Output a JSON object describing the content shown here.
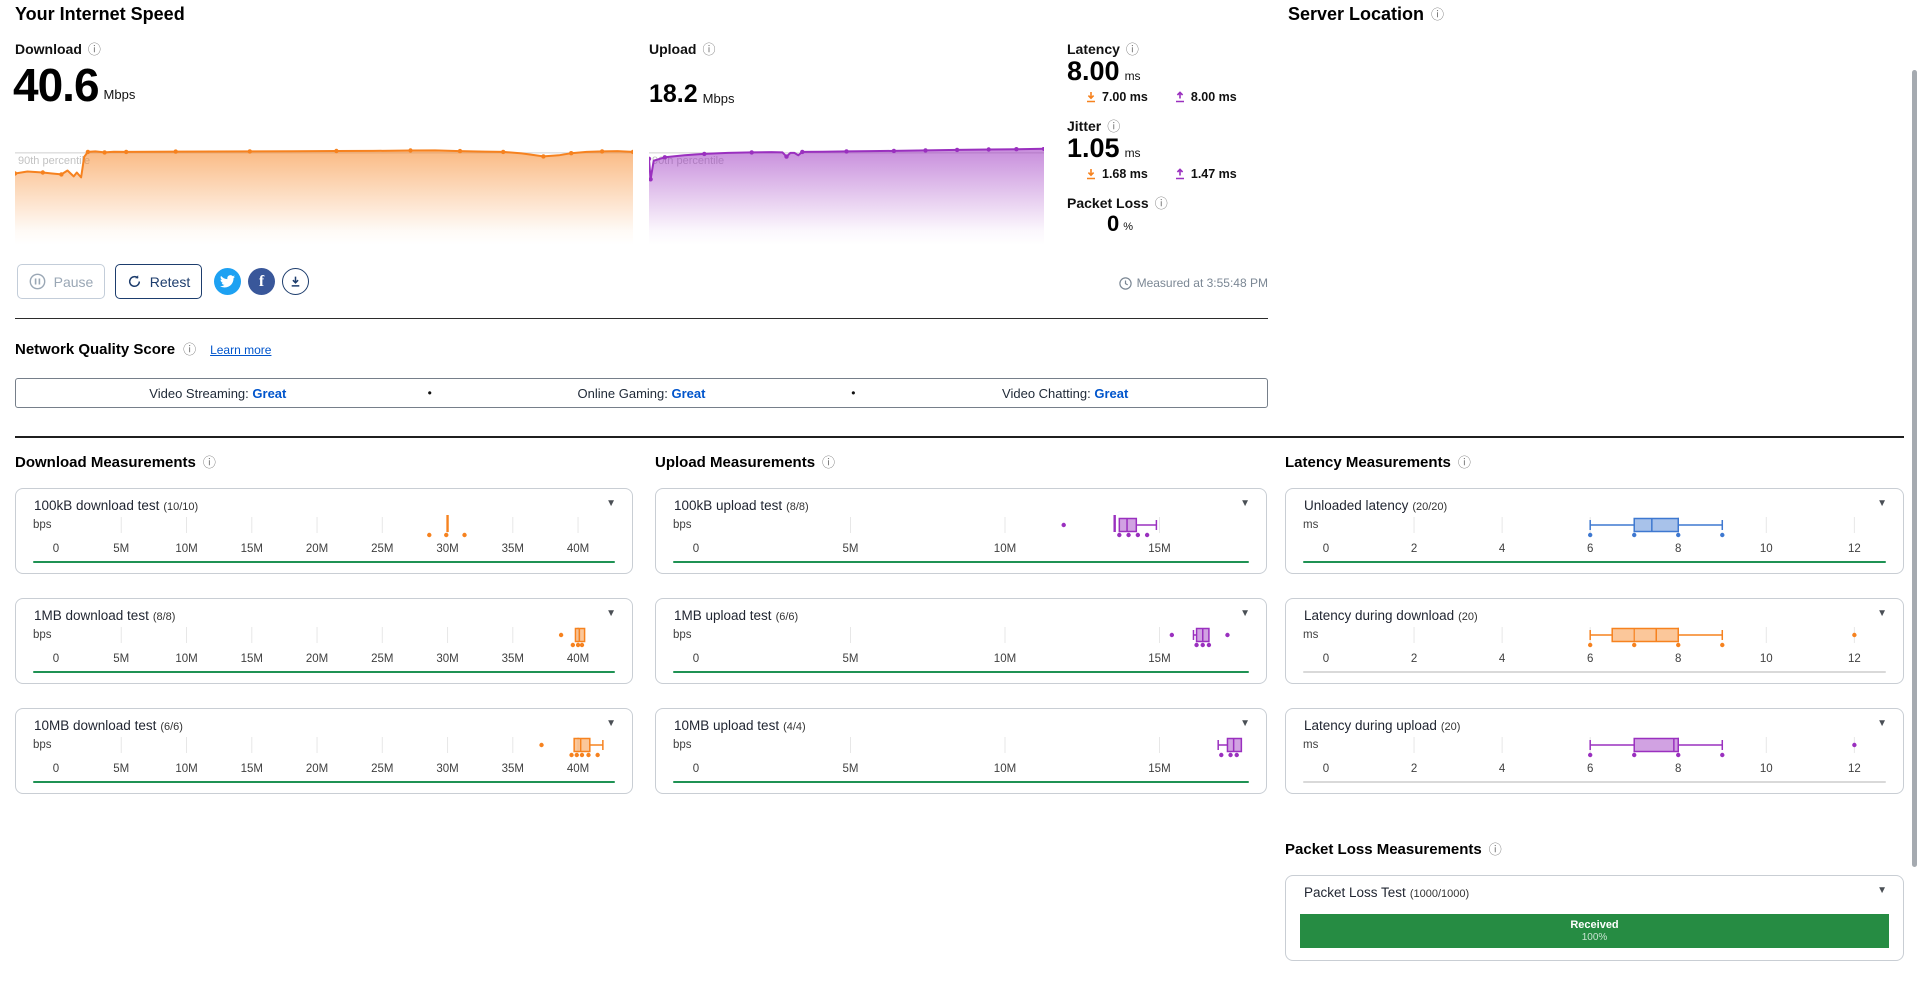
{
  "icons": {
    "info": "ⓘ",
    "caret": "▼",
    "bullet": "•",
    "facebook": "f"
  },
  "colors": {
    "orange": "#f6821f",
    "purple": "#9a30bf",
    "blue_box": "#3e78d0",
    "green_progress": "#1f9254",
    "gray_progress": "#d9d9d9",
    "packet_green": "#268c43",
    "navy": "#1d3d6d",
    "link_blue": "#0055cc",
    "twitter_blue": "#1da1f2",
    "facebook_blue": "#39579a"
  },
  "header": {
    "title": "Your Internet Speed",
    "server_location_title": "Server Location"
  },
  "speed": {
    "download": {
      "label": "Download",
      "value": "40.6",
      "unit": "Mbps"
    },
    "upload": {
      "label": "Upload",
      "value": "18.2",
      "unit": "Mbps"
    },
    "latency": {
      "label": "Latency",
      "value": "8.00",
      "unit": "ms",
      "download_sub": "7.00 ms",
      "upload_sub": "8.00 ms"
    },
    "jitter": {
      "label": "Jitter",
      "value": "1.05",
      "unit": "ms",
      "download_sub": "1.68 ms",
      "upload_sub": "1.47 ms"
    },
    "packet_loss": {
      "label": "Packet Loss",
      "value": "0",
      "unit": "%"
    }
  },
  "toolbar": {
    "pause": "Pause",
    "retest": "Retest",
    "measured_at": "Measured at 3:55:48 PM"
  },
  "quality": {
    "title": "Network Quality Score",
    "learn_more": "Learn more",
    "items": [
      {
        "label": "Video Streaming:",
        "value": "Great"
      },
      {
        "label": "Online Gaming:",
        "value": "Great"
      },
      {
        "label": "Video Chatting:",
        "value": "Great"
      }
    ]
  },
  "chart_data": [
    {
      "type": "area",
      "name": "download-speed",
      "color": "#f6821f",
      "percentile_label": "90th percentile",
      "percentile_y": 0.06,
      "points": [
        [
          0,
          0.27,
          1
        ],
        [
          0.02,
          0.25
        ],
        [
          0.045,
          0.26,
          1
        ],
        [
          0.06,
          0.27
        ],
        [
          0.075,
          0.28,
          1
        ],
        [
          0.085,
          0.24
        ],
        [
          0.095,
          0.3
        ],
        [
          0.1,
          0.26
        ],
        [
          0.107,
          0.31
        ],
        [
          0.112,
          0.1
        ],
        [
          0.118,
          0.05,
          1
        ],
        [
          0.13,
          0.045
        ],
        [
          0.145,
          0.055,
          1
        ],
        [
          0.16,
          0.048
        ],
        [
          0.18,
          0.05,
          1
        ],
        [
          0.22,
          0.048
        ],
        [
          0.26,
          0.047,
          1
        ],
        [
          0.32,
          0.046
        ],
        [
          0.38,
          0.045,
          1
        ],
        [
          0.45,
          0.043
        ],
        [
          0.52,
          0.041,
          1
        ],
        [
          0.58,
          0.04
        ],
        [
          0.64,
          0.036,
          1
        ],
        [
          0.68,
          0.035
        ],
        [
          0.72,
          0.042,
          1
        ],
        [
          0.76,
          0.047
        ],
        [
          0.79,
          0.05,
          1
        ],
        [
          0.82,
          0.065
        ],
        [
          0.855,
          0.096,
          1
        ],
        [
          0.88,
          0.085
        ],
        [
          0.9,
          0.063,
          1
        ],
        [
          0.925,
          0.05
        ],
        [
          0.95,
          0.045,
          1
        ],
        [
          0.975,
          0.042
        ],
        [
          1,
          0.05,
          1
        ]
      ]
    },
    {
      "type": "area",
      "name": "upload-speed",
      "color": "#9a30bf",
      "percentile_label": "90th percentile",
      "percentile_y": 0.06,
      "points": [
        [
          0,
          0.12,
          1
        ],
        [
          0.004,
          0.33,
          1
        ],
        [
          0.012,
          0.14
        ],
        [
          0.04,
          0.105,
          1
        ],
        [
          0.09,
          0.085
        ],
        [
          0.14,
          0.07,
          1
        ],
        [
          0.2,
          0.06
        ],
        [
          0.26,
          0.055,
          1
        ],
        [
          0.31,
          0.052
        ],
        [
          0.338,
          0.055
        ],
        [
          0.348,
          0.098,
          1
        ],
        [
          0.358,
          0.06
        ],
        [
          0.368,
          0.06
        ],
        [
          0.378,
          0.085
        ],
        [
          0.388,
          0.05,
          1
        ],
        [
          0.44,
          0.048
        ],
        [
          0.5,
          0.045,
          1
        ],
        [
          0.56,
          0.042
        ],
        [
          0.62,
          0.04,
          1
        ],
        [
          0.7,
          0.035,
          1
        ],
        [
          0.78,
          0.03,
          1
        ],
        [
          0.86,
          0.026,
          1
        ],
        [
          0.93,
          0.022,
          1
        ],
        [
          1,
          0.018,
          1
        ]
      ]
    }
  ],
  "measure_sections": [
    {
      "title": "Download Measurements",
      "cards": [
        {
          "title": "100kB download test",
          "count": "(10/10)",
          "unit": "bps",
          "tick_values": [
            0,
            5,
            10,
            15,
            20,
            25,
            30,
            35,
            40
          ],
          "tick_labels": [
            "0",
            "5M",
            "10M",
            "15M",
            "20M",
            "25M",
            "30M",
            "35M",
            "40M"
          ],
          "vmax": 42.6,
          "color": "#f6821f",
          "progress": "green",
          "plot": {
            "vline": 30,
            "dots": [
              28.6,
              29.9,
              31.3
            ]
          }
        },
        {
          "title": "1MB download test",
          "count": "(8/8)",
          "unit": "bps",
          "tick_values": [
            0,
            5,
            10,
            15,
            20,
            25,
            30,
            35,
            40
          ],
          "tick_labels": [
            "0",
            "5M",
            "10M",
            "15M",
            "20M",
            "25M",
            "30M",
            "35M",
            "40M"
          ],
          "vmax": 42.6,
          "color": "#f6821f",
          "progress": "green",
          "plot": {
            "box": {
              "lo": 39.8,
              "q1": 39.8,
              "med": 40.1,
              "q3": 40.5,
              "hi": 40.5
            },
            "dots": [
              39.6,
              40.0,
              40.3
            ],
            "outliers": [
              38.7
            ]
          }
        },
        {
          "title": "10MB download test",
          "count": "(6/6)",
          "unit": "bps",
          "tick_values": [
            0,
            5,
            10,
            15,
            20,
            25,
            30,
            35,
            40
          ],
          "tick_labels": [
            "0",
            "5M",
            "10M",
            "15M",
            "20M",
            "25M",
            "30M",
            "35M",
            "40M"
          ],
          "vmax": 42.6,
          "color": "#f6821f",
          "progress": "green",
          "plot": {
            "box": {
              "lo": 39.7,
              "q1": 39.7,
              "med": 40.2,
              "q3": 40.9,
              "hi": 41.9
            },
            "dots": [
              39.5,
              39.9,
              40.3,
              40.8,
              41.5
            ],
            "outliers": [
              37.2
            ]
          }
        }
      ]
    },
    {
      "title": "Upload Measurements",
      "cards": [
        {
          "title": "100kB upload test",
          "count": "(8/8)",
          "unit": "bps",
          "tick_values": [
            0,
            5,
            10,
            15
          ],
          "tick_labels": [
            "0",
            "5M",
            "10M",
            "15M"
          ],
          "vmax": 17.8,
          "color": "#9a30bf",
          "progress": "green",
          "plot": {
            "vline": 13.55,
            "box": {
              "lo": 13.7,
              "q1": 13.7,
              "med": 13.95,
              "q3": 14.25,
              "hi": 14.9
            },
            "dots": [
              13.7,
              14.0,
              14.3,
              14.6
            ],
            "outliers": [
              11.9
            ]
          }
        },
        {
          "title": "1MB upload test",
          "count": "(6/6)",
          "unit": "bps",
          "tick_values": [
            0,
            5,
            10,
            15
          ],
          "tick_labels": [
            "0",
            "5M",
            "10M",
            "15M"
          ],
          "vmax": 17.8,
          "color": "#9a30bf",
          "progress": "green",
          "plot": {
            "box": {
              "lo": 16.1,
              "q1": 16.2,
              "med": 16.4,
              "q3": 16.6,
              "hi": 16.6
            },
            "dots": [
              16.2,
              16.4,
              16.6
            ],
            "outliers": [
              15.4,
              17.2
            ]
          }
        },
        {
          "title": "10MB upload test",
          "count": "(4/4)",
          "unit": "bps",
          "tick_values": [
            0,
            5,
            10,
            15
          ],
          "tick_labels": [
            "0",
            "5M",
            "10M",
            "15M"
          ],
          "vmax": 17.8,
          "color": "#9a30bf",
          "progress": "green",
          "plot": {
            "box": {
              "lo": 16.9,
              "q1": 17.2,
              "med": 17.4,
              "q3": 17.65,
              "hi": 17.65
            },
            "dots": [
              17.0,
              17.3,
              17.5
            ]
          }
        }
      ]
    },
    {
      "title": "Latency Measurements",
      "cards": [
        {
          "title": "Unloaded latency",
          "count": "(20/20)",
          "unit": "ms",
          "tick_values": [
            0,
            2,
            4,
            6,
            8,
            10,
            12
          ],
          "tick_labels": [
            "0",
            "2",
            "4",
            "6",
            "8",
            "10",
            "12"
          ],
          "vmax": 12.65,
          "color": "#3e78d0",
          "progress": "green",
          "plot": {
            "box": {
              "lo": 6,
              "q1": 7,
              "med": 7.4,
              "q3": 8,
              "hi": 9
            },
            "dots": [
              6,
              7,
              8,
              9
            ]
          }
        },
        {
          "title": "Latency during download",
          "count": "(20)",
          "unit": "ms",
          "tick_values": [
            0,
            2,
            4,
            6,
            8,
            10,
            12
          ],
          "tick_labels": [
            "0",
            "2",
            "4",
            "6",
            "8",
            "10",
            "12"
          ],
          "vmax": 12.65,
          "color": "#f6821f",
          "progress": "gray",
          "plot": {
            "box": {
              "lo": 6,
              "q1": 6.5,
              "med": 7.5,
              "med2": 7.0,
              "q3": 8,
              "hi": 9
            },
            "dots": [
              6,
              7,
              8,
              9
            ],
            "outliers": [
              12
            ]
          }
        },
        {
          "title": "Latency during upload",
          "count": "(20)",
          "unit": "ms",
          "tick_values": [
            0,
            2,
            4,
            6,
            8,
            10,
            12
          ],
          "tick_labels": [
            "0",
            "2",
            "4",
            "6",
            "8",
            "10",
            "12"
          ],
          "vmax": 12.65,
          "color": "#9a30bf",
          "progress": "gray",
          "plot": {
            "box": {
              "lo": 6,
              "q1": 7,
              "med": 7.9,
              "q3": 8,
              "hi": 9
            },
            "dots": [
              6,
              7,
              8,
              9
            ],
            "outliers": [
              12
            ]
          }
        }
      ]
    },
    {
      "title": "Packet Loss Measurements",
      "cards": [
        {
          "title": "Packet Loss Test",
          "count": "(1000/1000)",
          "bar": {
            "label": "Received",
            "pct": "100%",
            "color": "#268c43"
          }
        }
      ]
    }
  ]
}
